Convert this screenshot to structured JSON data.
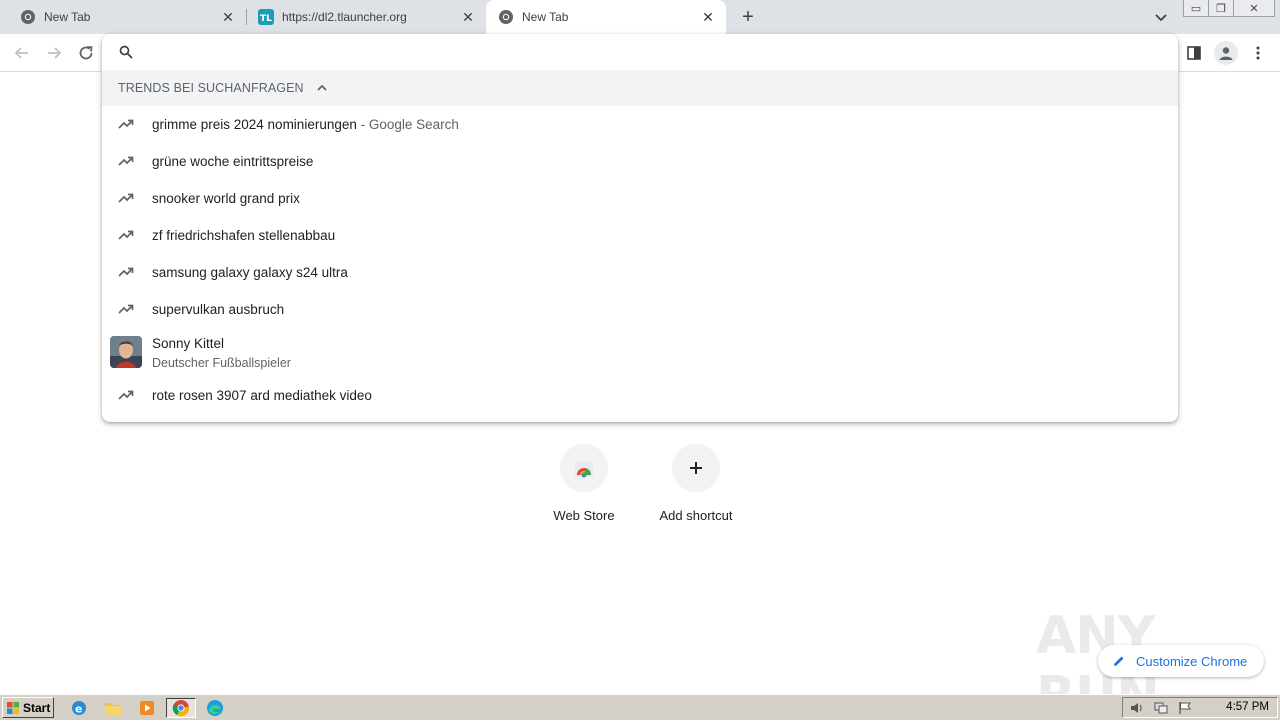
{
  "tabs": [
    {
      "title": "New Tab",
      "icon": "chrome-icon"
    },
    {
      "title": "https://dl2.tlauncher.org",
      "icon": "tlauncher-icon"
    },
    {
      "title": "New Tab",
      "icon": "chrome-icon",
      "active": true
    }
  ],
  "omnibox": {
    "value": "",
    "header": "TRENDS BEI SUCHANFRAGEN",
    "suggestions": [
      {
        "text": "grimme preis 2024 nominierungen",
        "suffix": " - Google Search"
      },
      {
        "text": "grüne woche eintrittspreise"
      },
      {
        "text": "snooker world grand prix"
      },
      {
        "text": "zf friedrichshafen stellenabbau"
      },
      {
        "text": "samsung galaxy galaxy s24 ultra"
      },
      {
        "text": "supervulkan ausbruch"
      }
    ],
    "entity": {
      "title": "Sonny Kittel",
      "subtitle": "Deutscher Fußballspieler"
    },
    "last_suggestion": {
      "text": "rote rosen 3907 ard mediathek video"
    }
  },
  "shortcuts": [
    {
      "label": "Web Store",
      "icon": "web-store-icon"
    },
    {
      "label": "Add shortcut",
      "icon": "plus-icon"
    }
  ],
  "customize_label": "Customize Chrome",
  "watermark": "ANY RUN",
  "taskbar": {
    "start_label": "Start",
    "clock": "4:57 PM"
  },
  "colors": {
    "accent": "#1a73e8",
    "tabstrip": "#dee1e6",
    "taskbar": "#d4d0c8"
  }
}
